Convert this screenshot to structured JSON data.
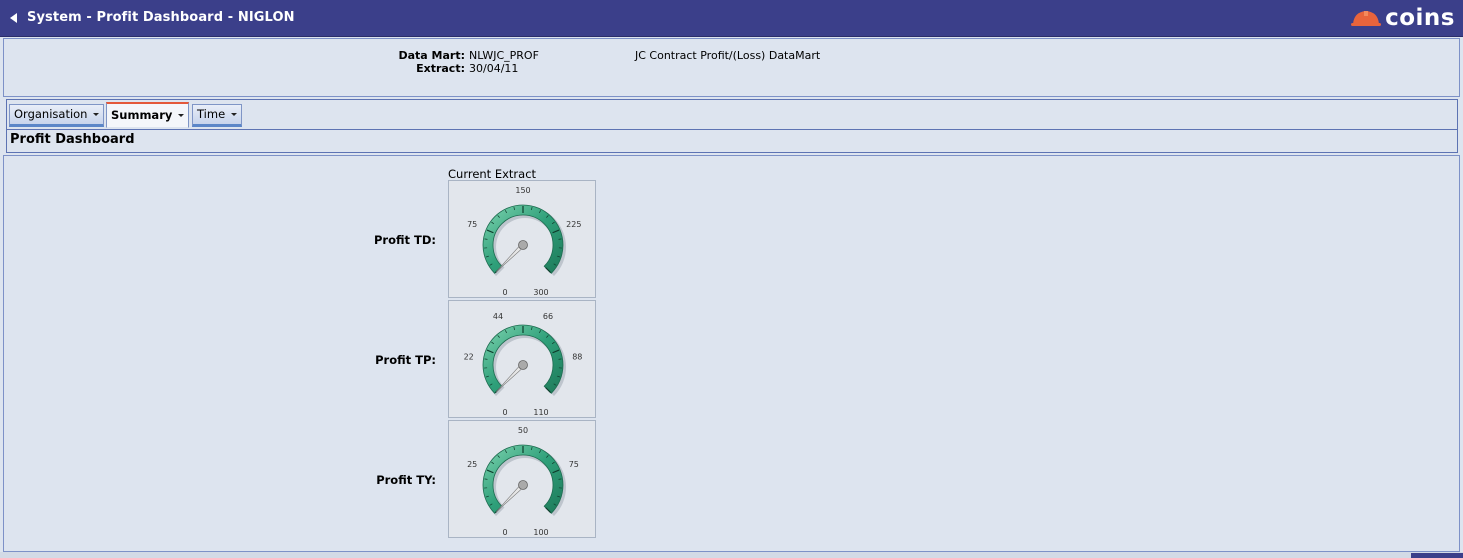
{
  "window": {
    "title": "System - Profit Dashboard - NIGLON",
    "logo_text": "coins",
    "brand_color": "#3b3f8a",
    "accent_color": "#e4583a"
  },
  "header": {
    "data_mart_label": "Data Mart:",
    "data_mart_value": "NLWJC_PROF",
    "extract_label": "Extract:",
    "extract_value": "30/04/11",
    "description": "JC Contract Profit/(Loss) DataMart"
  },
  "tabs": [
    {
      "label": "Organisation",
      "active": false
    },
    {
      "label": "Summary",
      "active": true
    },
    {
      "label": "Time",
      "active": false
    }
  ],
  "section_title": "Profit Dashboard",
  "column_title": "Current Extract",
  "gauges": [
    {
      "label": "Profit TD:",
      "ticks": [
        "0",
        "75",
        "150",
        "225",
        "300"
      ],
      "max": 300,
      "value": 0
    },
    {
      "label": "Profit TP:",
      "ticks": [
        "0",
        "22",
        "44",
        "66",
        "88",
        "110"
      ],
      "max": 110,
      "value": 0
    },
    {
      "label": "Profit TY:",
      "ticks": [
        "0",
        "25",
        "50",
        "75",
        "100"
      ],
      "max": 100,
      "value": 0
    }
  ],
  "icons": {
    "back": "back-arrow-icon",
    "caret": "chevron-down-icon",
    "logo": "hard-hat-icon"
  }
}
